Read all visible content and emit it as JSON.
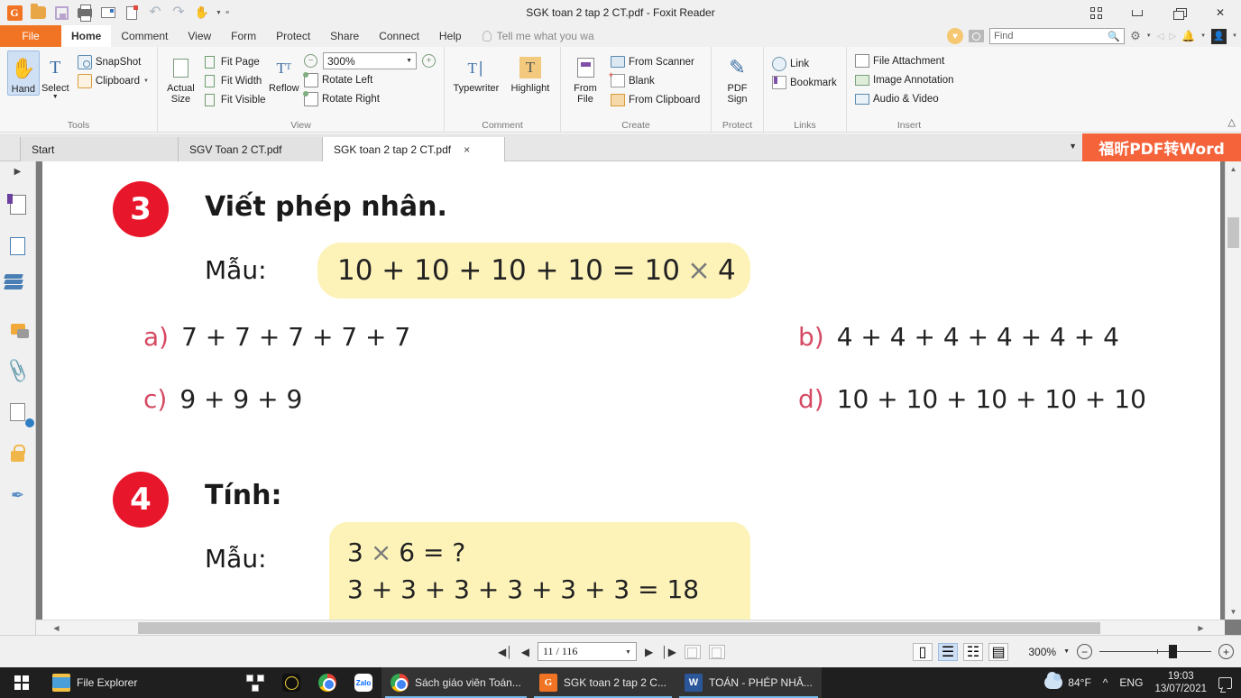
{
  "titlebar": {
    "document_title": "SGK toan 2 tap 2 CT.pdf - Foxit Reader",
    "quick_access": [
      {
        "name": "foxit-logo",
        "label": "Foxit"
      },
      {
        "name": "open-icon",
        "label": "Open"
      },
      {
        "name": "save-icon",
        "label": "Save"
      },
      {
        "name": "print-icon",
        "label": "Print"
      },
      {
        "name": "email-icon",
        "label": "Email"
      },
      {
        "name": "new-document-icon",
        "label": "New"
      },
      {
        "name": "undo-icon",
        "label": "Undo"
      },
      {
        "name": "redo-icon",
        "label": "Redo"
      },
      {
        "name": "hand-tool-icon",
        "label": "Hand"
      }
    ],
    "window_buttons": {
      "tile": "tile-windows",
      "minimize": "minimize",
      "restore": "restore-down",
      "close": "close"
    }
  },
  "menubar": {
    "file": "File",
    "items": [
      {
        "label": "Home",
        "active": true
      },
      {
        "label": "Comment",
        "active": false
      },
      {
        "label": "View",
        "active": false
      },
      {
        "label": "Form",
        "active": false
      },
      {
        "label": "Protect",
        "active": false
      },
      {
        "label": "Share",
        "active": false
      },
      {
        "label": "Connect",
        "active": false
      },
      {
        "label": "Help",
        "active": false
      }
    ],
    "tell_me": "Tell me what you wa",
    "find_placeholder": "Find",
    "find_value": ""
  },
  "ribbon": {
    "groups": [
      {
        "name": "Tools",
        "label": "Tools",
        "big_buttons": [
          {
            "label": "Hand",
            "icon": "hand-icon",
            "selected": true
          },
          {
            "label": "Select",
            "icon": "select-icon",
            "selected": false
          }
        ],
        "small_buttons": [
          {
            "label": "SnapShot",
            "icon": "camera-icon"
          },
          {
            "label": "Clipboard",
            "icon": "clipboard-icon",
            "has_caret": true
          }
        ]
      },
      {
        "name": "View",
        "label": "View",
        "big_buttons": [
          {
            "label": "Actual Size",
            "icon": "actual-size-icon"
          },
          {
            "label": "Reflow",
            "icon": "reflow-icon"
          }
        ],
        "small_buttons": [
          {
            "label": "Fit Page",
            "icon": "fit-page-icon"
          },
          {
            "label": "Fit Width",
            "icon": "fit-width-icon"
          },
          {
            "label": "Fit Visible",
            "icon": "fit-visible-icon"
          },
          {
            "label": "Rotate Left",
            "icon": "rotate-left-icon"
          },
          {
            "label": "Rotate Right",
            "icon": "rotate-right-icon"
          }
        ],
        "zoom_value": "300%"
      },
      {
        "name": "Comment",
        "label": "Comment",
        "big_buttons": [
          {
            "label": "Typewriter",
            "icon": "typewriter-icon"
          },
          {
            "label": "Highlight",
            "icon": "highlight-icon"
          }
        ]
      },
      {
        "name": "Create",
        "label": "Create",
        "big_buttons": [
          {
            "label": "From File",
            "icon": "from-file-icon"
          }
        ],
        "small_buttons": [
          {
            "label": "From Scanner",
            "icon": "scanner-icon"
          },
          {
            "label": "Blank",
            "icon": "blank-page-icon"
          },
          {
            "label": "From Clipboard",
            "icon": "from-clipboard-icon"
          }
        ]
      },
      {
        "name": "Protect",
        "label": "Protect",
        "big_buttons": [
          {
            "label": "PDF Sign",
            "icon": "pdf-sign-icon"
          }
        ]
      },
      {
        "name": "Links",
        "label": "Links",
        "small_buttons": [
          {
            "label": "Link",
            "icon": "link-icon"
          },
          {
            "label": "Bookmark",
            "icon": "bookmark-icon"
          }
        ]
      },
      {
        "name": "Insert",
        "label": "Insert",
        "small_buttons": [
          {
            "label": "File Attachment",
            "icon": "file-attachment-icon"
          },
          {
            "label": "Image Annotation",
            "icon": "image-annotation-icon"
          },
          {
            "label": "Audio & Video",
            "icon": "audio-video-icon"
          }
        ]
      }
    ]
  },
  "tabstrip": {
    "tabs": [
      {
        "label": "Start",
        "active": false,
        "closable": false
      },
      {
        "label": "SGV Toan 2 CT.pdf",
        "active": false,
        "closable": false
      },
      {
        "label": "SGK toan 2 tap 2 CT.pdf",
        "active": true,
        "closable": true
      }
    ],
    "close_glyph": "×",
    "promo_banner": "福昕PDF转Word"
  },
  "leftnav": {
    "items": [
      {
        "name": "bookmarks-panel",
        "label": "Bookmarks"
      },
      {
        "name": "pages-panel",
        "label": "Page Thumbnails"
      },
      {
        "name": "layers-panel",
        "label": "Layers"
      },
      {
        "name": "comments-panel",
        "label": "Comments"
      },
      {
        "name": "attachments-panel",
        "label": "Attachments"
      },
      {
        "name": "digital-signatures-panel",
        "label": "Digital Signatures"
      },
      {
        "name": "security-panel",
        "label": "Security"
      },
      {
        "name": "signature-panel",
        "label": "Signature"
      }
    ]
  },
  "document": {
    "exercises": [
      {
        "number": "3",
        "heading": "Viết phép nhân.",
        "sample_label": "Mẫu:",
        "sample_left": "10 + 10 + 10 + 10 = 10",
        "sample_times": "×",
        "sample_right": "4",
        "problems": [
          {
            "label": "a)",
            "text": "7 + 7 + 7 + 7 + 7"
          },
          {
            "label": "b)",
            "text": "4 + 4 + 4 + 4 + 4 + 4"
          },
          {
            "label": "c)",
            "text": "9 + 9 + 9"
          },
          {
            "label": "d)",
            "text": "10 + 10 + 10 + 10 + 10"
          }
        ]
      },
      {
        "number": "4",
        "heading": "Tính:",
        "sample_label": "Mẫu:",
        "sample_line1_left": "3",
        "sample_line1_times": "×",
        "sample_line1_right": "6 = ?",
        "sample_line2": "3 + 3 + 3 + 3 + 3 + 3 = 18"
      }
    ]
  },
  "statusbar": {
    "page_value": "11 / 116",
    "first_page": "first-page",
    "prev_page": "previous-page",
    "next_page": "next-page",
    "last_page": "last-page",
    "view_modes": [
      {
        "name": "single-page-view",
        "selected": false
      },
      {
        "name": "continuous-view",
        "selected": true
      },
      {
        "name": "facing-view",
        "selected": false
      },
      {
        "name": "continuous-facing-view",
        "selected": false
      }
    ],
    "zoom_level": "300%"
  },
  "taskbar": {
    "start_label": "Start",
    "items": [
      {
        "name": "taskbar-file-explorer",
        "label": "File Explorer",
        "icon": "folder-icon",
        "open": false,
        "wide": true
      },
      {
        "name": "taskbar-unikey",
        "label": "",
        "icon": "unikey-icon",
        "open": false,
        "wide": false
      },
      {
        "name": "taskbar-cursor-tool",
        "label": "",
        "icon": "cursor-icon",
        "open": false,
        "wide": false
      },
      {
        "name": "taskbar-chrome",
        "label": "",
        "icon": "chrome-icon",
        "open": false,
        "wide": false
      },
      {
        "name": "taskbar-zalo",
        "label": "Zalo",
        "icon": "zalo-icon",
        "open": false,
        "wide": false
      },
      {
        "name": "taskbar-chrome-window",
        "label": "Sách giáo viên Toán...",
        "icon": "chrome-icon",
        "open": true,
        "wide": false
      },
      {
        "name": "taskbar-foxit-reader",
        "label": "SGK toan 2 tap 2 C...",
        "icon": "foxit-icon",
        "open": true,
        "wide": false
      },
      {
        "name": "taskbar-word",
        "label": "TOÁN - PHÉP NHÂ...",
        "icon": "word-icon",
        "open": true,
        "wide": false
      }
    ],
    "tray": {
      "weather": "84°F",
      "show_hidden": "^",
      "language": "ENG",
      "time": "19:03",
      "date": "13/07/2021",
      "action_center": "notifications"
    }
  },
  "colors": {
    "accent_orange": "#f07423",
    "promo_orange": "#f4633a",
    "exercise_red": "#e8162a",
    "highlight_yellow": "#fdf3b8",
    "label_pink": "#d64a63",
    "selection_blue": "#cfe0f5"
  }
}
